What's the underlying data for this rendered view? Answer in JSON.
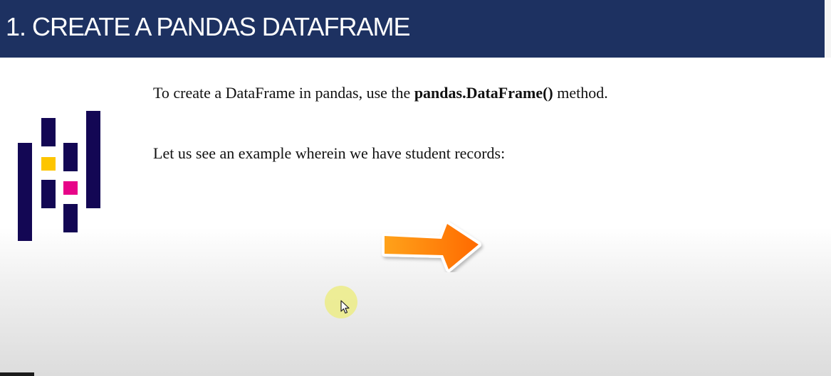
{
  "slide": {
    "title": "1. CREATE A PANDAS DATAFRAME",
    "paragraph1": {
      "before": "To create a DataFrame in pandas, use the ",
      "bold": "pandas.DataFrame()",
      "after": " method."
    },
    "paragraph2": "Let us see an example wherein we have student records:"
  },
  "icons": {
    "logo": "pandas-logo-icon",
    "arrow": "right-arrow-icon",
    "cursor": "mouse-pointer-icon"
  },
  "colors": {
    "title_bar": "#1d3161",
    "logo_bars": "#130754",
    "logo_yellow": "#fdc500",
    "logo_pink": "#e70488",
    "arrow_start": "#ffa21a",
    "arrow_end": "#ff6a00"
  }
}
